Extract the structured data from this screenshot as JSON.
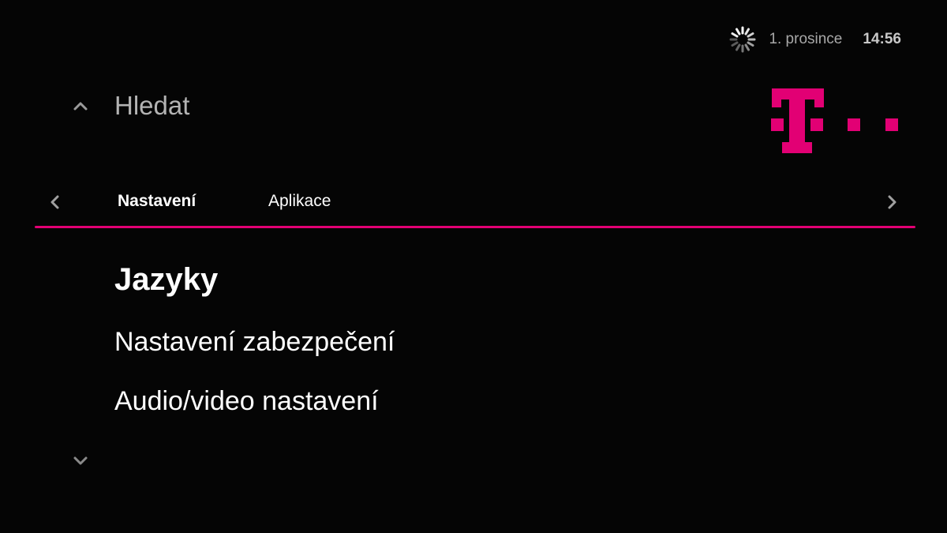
{
  "status": {
    "date": "1. prosince",
    "time": "14:56",
    "loading_icon": "spinner-icon"
  },
  "search": {
    "label": "Hledat",
    "icon": "chevron-up-icon"
  },
  "brand": {
    "name": "Telekom",
    "logo_color": "#e20074"
  },
  "tabs": {
    "items": [
      {
        "label": "Nastavení",
        "active": true
      },
      {
        "label": "Aplikace",
        "active": false
      }
    ],
    "prev_icon": "chevron-left-icon",
    "next_icon": "chevron-right-icon"
  },
  "menu": {
    "items": [
      {
        "label": "Jazyky",
        "selected": true
      },
      {
        "label": "Nastavení zabezpečení",
        "selected": false
      },
      {
        "label": "Audio/video nastavení",
        "selected": false
      }
    ],
    "more_icon": "chevron-down-icon"
  },
  "colors": {
    "background": "#050505",
    "accent": "#e20074",
    "text_primary": "#ffffff",
    "text_secondary": "#b3b3b3"
  }
}
